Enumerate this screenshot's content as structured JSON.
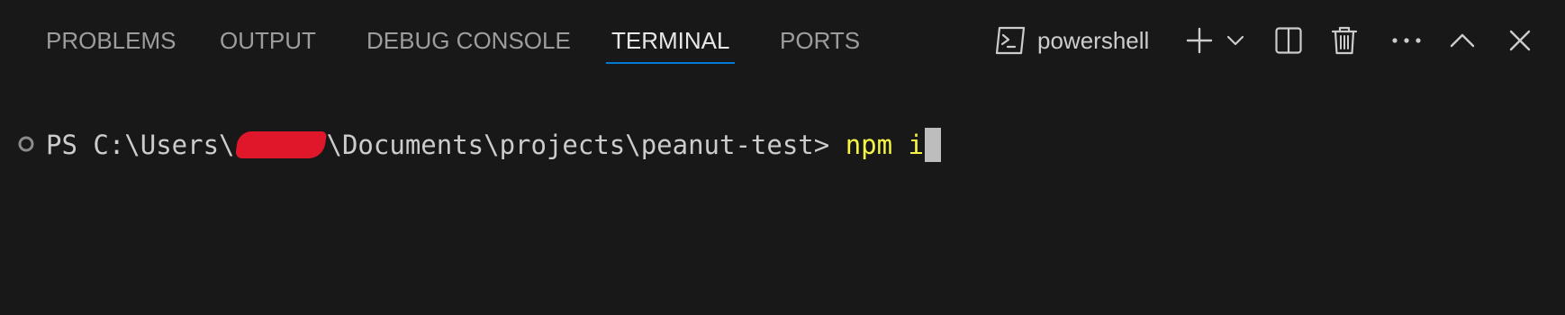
{
  "tabs": [
    {
      "label": "PROBLEMS",
      "active": false
    },
    {
      "label": "OUTPUT",
      "active": false
    },
    {
      "label": "DEBUG CONSOLE",
      "active": false
    },
    {
      "label": "TERMINAL",
      "active": true
    },
    {
      "label": "PORTS",
      "active": false
    }
  ],
  "toolbar": {
    "terminal_name": "powershell",
    "icons": [
      "terminal-icon",
      "plus-icon",
      "chevron-down-icon",
      "split-icon",
      "trash-icon",
      "ellipsis-icon",
      "chevron-up-icon",
      "close-icon"
    ]
  },
  "terminal": {
    "prompt_prefix": "PS C:\\Users\\",
    "prompt_suffix": "\\Documents\\projects\\peanut-test> ",
    "command": "npm i"
  },
  "colors": {
    "background": "#181818",
    "tab_inactive": "#9d9d9d",
    "tab_active": "#e7e7e7",
    "active_underline": "#0078d4",
    "command": "#f5f543",
    "redaction": "#e0162b",
    "cursor": "#bdbdbd"
  }
}
